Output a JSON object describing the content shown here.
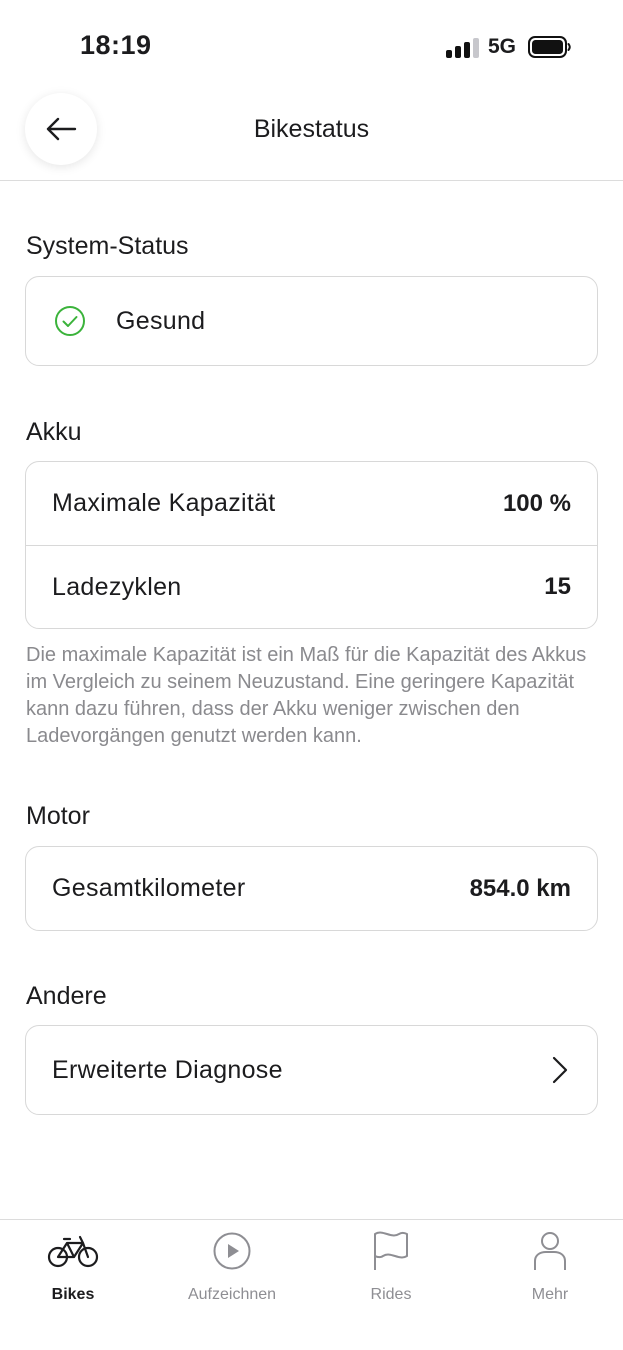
{
  "status_bar": {
    "time": "18:19",
    "network": "5G",
    "signal_bars_filled": 3,
    "signal_bars_total": 4
  },
  "header": {
    "title": "Bikestatus",
    "back_icon": "arrow-left-icon"
  },
  "system_status": {
    "title": "System-Status",
    "status": "Gesund",
    "status_icon": "check-circle-icon",
    "status_color": "#3bb33b"
  },
  "akku": {
    "title": "Akku",
    "rows": [
      {
        "label": "Maximale Kapazität",
        "value": "100 %"
      },
      {
        "label": "Ladezyklen",
        "value": "15"
      }
    ],
    "note": "Die maximale Kapazität ist ein Maß für die Kapazität des Akkus im Vergleich zu seinem Neuzustand. Eine geringere Kapazität kann dazu führen, dass der Akku weniger zwischen den Ladevorgängen genutzt werden kann."
  },
  "motor": {
    "title": "Motor",
    "rows": [
      {
        "label": "Gesamtkilometer",
        "value": "854.0 km"
      }
    ]
  },
  "andere": {
    "title": "Andere",
    "items": [
      {
        "label": "Erweiterte Diagnose",
        "icon": "chevron-right-icon"
      }
    ]
  },
  "tabbar": {
    "tabs": [
      {
        "label": "Bikes",
        "icon": "bike-icon",
        "active": true
      },
      {
        "label": "Aufzeichnen",
        "icon": "play-circle-icon",
        "active": false
      },
      {
        "label": "Rides",
        "icon": "flag-icon",
        "active": false
      },
      {
        "label": "Mehr",
        "icon": "person-icon",
        "active": false
      }
    ]
  }
}
